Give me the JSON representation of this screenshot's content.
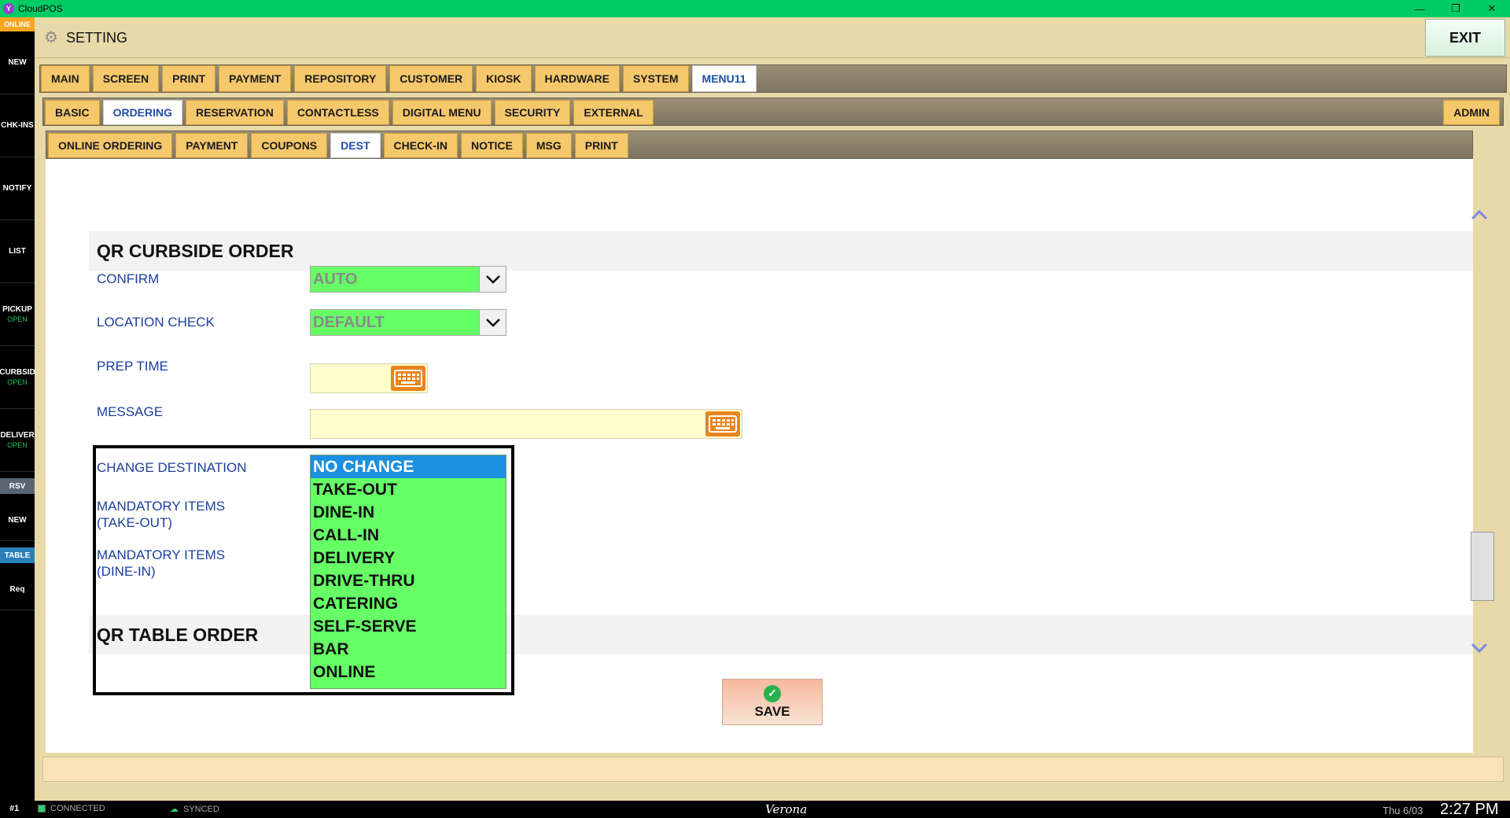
{
  "window": {
    "app_title": "CloudPOS",
    "minimize": "—",
    "restore": "❐",
    "close": "✕"
  },
  "sidebar": {
    "online": "ONLINE",
    "items": [
      {
        "label": "NEW",
        "sub": ""
      },
      {
        "label": "CHK-INS",
        "sub": ""
      },
      {
        "label": "NOTIFY",
        "sub": ""
      },
      {
        "label": "LIST",
        "sub": ""
      },
      {
        "label": "PICKUP",
        "sub": "OPEN"
      },
      {
        "label": "CURBSID",
        "sub": "OPEN"
      },
      {
        "label": "DELIVER",
        "sub": "OPEN"
      }
    ],
    "rsv_label": "RSV",
    "new2_label": "NEW",
    "table_label": "TABLE",
    "req_label": "Req"
  },
  "header": {
    "title": "SETTING",
    "exit_label": "EXIT"
  },
  "tabs_main": [
    {
      "label": "MAIN",
      "active": false
    },
    {
      "label": "SCREEN",
      "active": false
    },
    {
      "label": "PRINT",
      "active": false
    },
    {
      "label": "PAYMENT",
      "active": false
    },
    {
      "label": "REPOSITORY",
      "active": false
    },
    {
      "label": "CUSTOMER",
      "active": false
    },
    {
      "label": "KIOSK",
      "active": false
    },
    {
      "label": "HARDWARE",
      "active": false
    },
    {
      "label": "SYSTEM",
      "active": false
    },
    {
      "label": "MENU11",
      "active": true
    }
  ],
  "tabs_sub": [
    {
      "label": "BASIC",
      "active": false
    },
    {
      "label": "ORDERING",
      "active": true
    },
    {
      "label": "RESERVATION",
      "active": false
    },
    {
      "label": "CONTACTLESS",
      "active": false
    },
    {
      "label": "DIGITAL MENU",
      "active": false
    },
    {
      "label": "SECURITY",
      "active": false
    },
    {
      "label": "EXTERNAL",
      "active": false
    }
  ],
  "admin_label": "ADMIN",
  "tabs_third": [
    {
      "label": "ONLINE ORDERING",
      "active": false
    },
    {
      "label": "PAYMENT",
      "active": false
    },
    {
      "label": "COUPONS",
      "active": false
    },
    {
      "label": "DEST",
      "active": true
    },
    {
      "label": "CHECK-IN",
      "active": false
    },
    {
      "label": "NOTICE",
      "active": false
    },
    {
      "label": "MSG",
      "active": false
    },
    {
      "label": "PRINT",
      "active": false
    }
  ],
  "section1": {
    "title": "QR CURBSIDE ORDER",
    "confirm_label": "CONFIRM",
    "confirm_value": "AUTO",
    "location_label": "LOCATION CHECK",
    "location_value": "DEFAULT",
    "prep_label": "PREP TIME",
    "prep_value": "",
    "message_label": "MESSAGE",
    "message_value": "",
    "change_dest_label": "CHANGE DESTINATION",
    "mandatory_takeout_line1": "MANDATORY ITEMS",
    "mandatory_takeout_line2": "(TAKE-OUT)",
    "mandatory_dinein_line1": "MANDATORY ITEMS",
    "mandatory_dinein_line2": "(DINE-IN)"
  },
  "destination_options": [
    "NO CHANGE",
    "TAKE-OUT",
    "DINE-IN",
    "CALL-IN",
    "DELIVERY",
    "DRIVE-THRU",
    "CATERING",
    "SELF-SERVE",
    "BAR",
    "ONLINE"
  ],
  "destination_selected": "NO CHANGE",
  "section2": {
    "title": "QR TABLE ORDER"
  },
  "save_label": "SAVE",
  "status": {
    "station": "#1",
    "connected": "CONNECTED",
    "synced": "SYNCED",
    "store": "Verona",
    "date": "Thu 6/03",
    "time": "2:27 PM"
  },
  "colors": {
    "titlebar": "#00cc66",
    "tab": "#f6c86c",
    "active_tab_text": "#1d4ea8",
    "dropdown_bg": "#66ff66",
    "selected_option": "#1c90e0",
    "field_label": "#1a3f9c"
  }
}
